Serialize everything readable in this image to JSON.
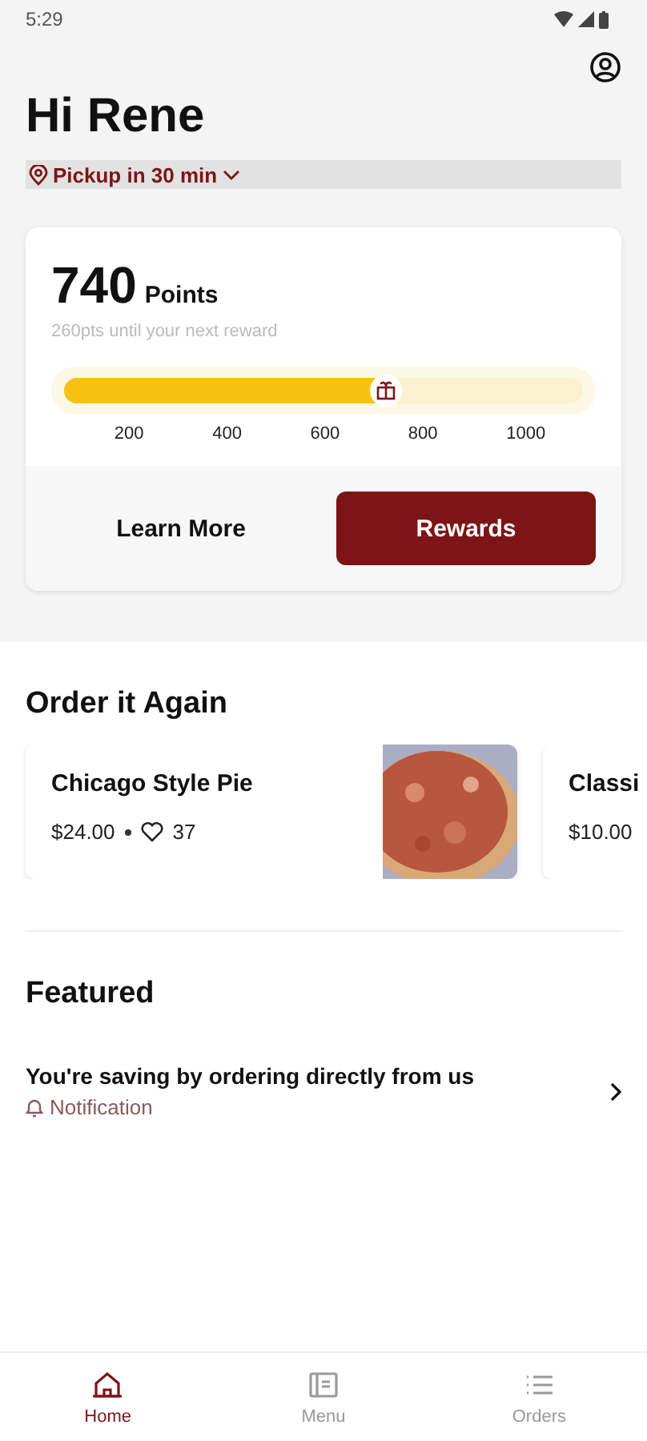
{
  "status_bar": {
    "time": "5:29"
  },
  "greeting": "Hi Rene",
  "pickup": {
    "label": "Pickup in 30 min"
  },
  "rewards": {
    "points": "740",
    "points_label": "Points",
    "subtitle": "260pts until your next reward",
    "level": 0.62,
    "ticks": [
      "200",
      "400",
      "600",
      "800",
      "1000"
    ],
    "learn_more": "Learn More",
    "rewards_button": "Rewards"
  },
  "order_again": {
    "title": "Order it Again",
    "items": [
      {
        "name": "Chicago Style Pie",
        "price": "$24.00",
        "likes": "37",
        "kind": "picture"
      },
      {
        "name": "Classi",
        "price": "$10.00"
      }
    ]
  },
  "featured": {
    "title": "Featured",
    "items": [
      {
        "title": "You're saving by ordering directly from us",
        "tag": "Notification"
      }
    ]
  },
  "nav": [
    {
      "label": "Home",
      "kind": "home",
      "selected": true
    },
    {
      "label": "Menu",
      "kind": "menu",
      "selected": false
    },
    {
      "label": "Orders",
      "kind": "orders",
      "selected": false
    }
  ]
}
